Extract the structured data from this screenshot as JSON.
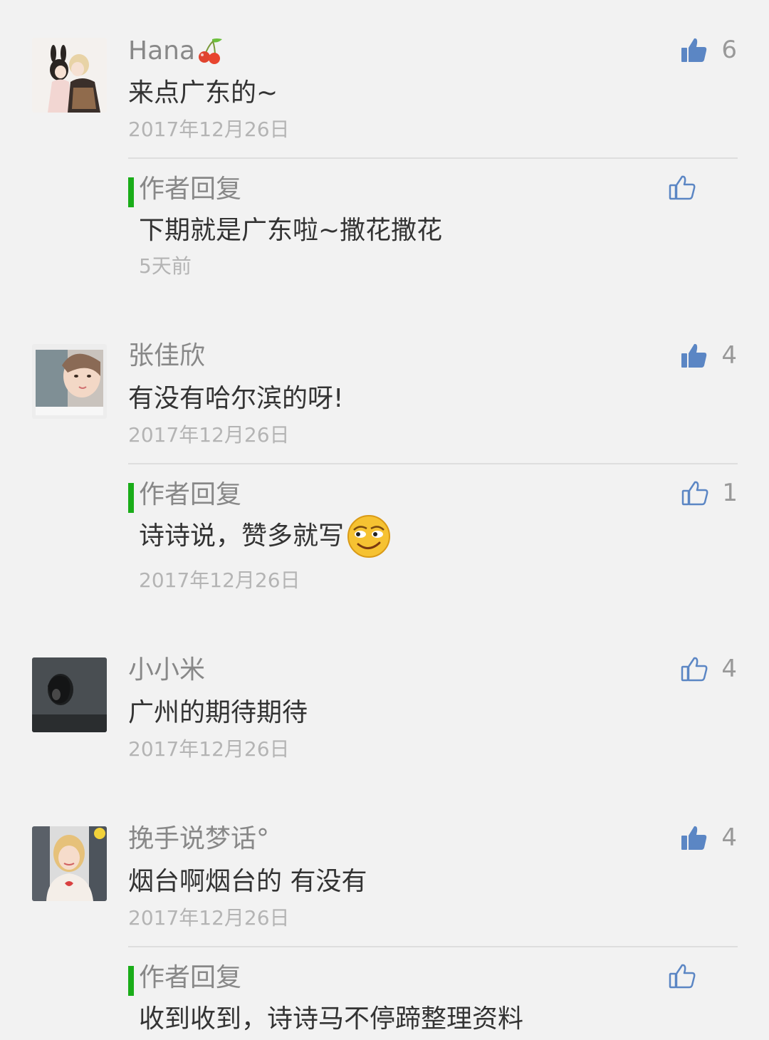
{
  "colors": {
    "background": "#f2f2f2",
    "like_active": "#5b86c4",
    "like_inactive": "#9aa7b8",
    "reply_accent": "#1aad19"
  },
  "comments": [
    {
      "user": "Hana",
      "user_icon": "cherry-icon",
      "text": "来点广东的~",
      "date": "2017年12月26日",
      "likes": "6",
      "liked": true,
      "reply": {
        "label": "作者回复",
        "text": "下期就是广东啦~撒花撒花",
        "date": "5天前",
        "likes": ""
      }
    },
    {
      "user": "张佳欣",
      "text": "有没有哈尔滨的呀!",
      "date": "2017年12月26日",
      "likes": "4",
      "liked": true,
      "reply": {
        "label": "作者回复",
        "text": "诗诗说，赞多就写",
        "emoji": "smirk-emoji",
        "date": "2017年12月26日",
        "likes": "1"
      }
    },
    {
      "user": "小小米",
      "text": "广州的期待期待",
      "date": "2017年12月26日",
      "likes": "4",
      "liked": false
    },
    {
      "user": "挽手说梦话°",
      "text": "烟台啊烟台的 有没有",
      "date": "2017年12月26日",
      "likes": "4",
      "liked": true,
      "reply": {
        "label": "作者回复",
        "text": "收到收到，诗诗马不停蹄整理资料",
        "likes": ""
      }
    }
  ]
}
